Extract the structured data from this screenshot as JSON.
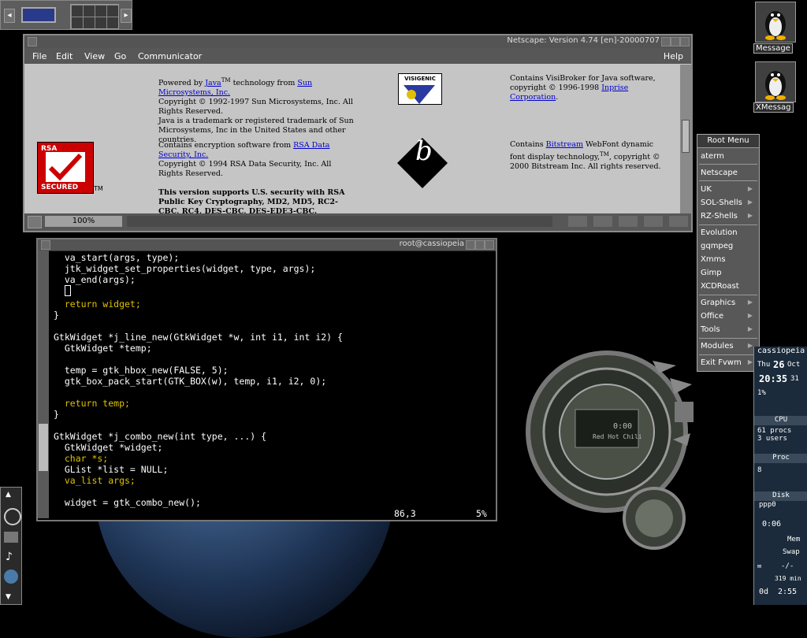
{
  "pager": {
    "left_btn": "◂",
    "right_btn": "▸"
  },
  "netscape": {
    "title": "Netscape: Version 4.74 [en]-20000707",
    "menu": [
      "File",
      "Edit",
      "View",
      "Go",
      "Communicator"
    ],
    "help": "Help",
    "col1": {
      "powered_prefix": "Powered by ",
      "java_link": "Java",
      "tm": "TM",
      "powered_mid": " technology from ",
      "sun_link": "Sun Microsystems, Inc.",
      "copyright_sun": "Copyright © 1992-1997 Sun Microsystems, Inc. All Rights Reserved.",
      "java_tm": "Java is a trademark or registered trademark of Sun Microsystems, Inc in the United States and other countries.",
      "rsa_prefix": "Contains encryption software from ",
      "rsa_link": "RSA Data Security, Inc.",
      "rsa_copyright": "Copyright © 1994 RSA Data Security, Inc. All Rights Reserved.",
      "security_text": "This version supports U.S. security with RSA Public Key Cryptography, MD2, MD5, RC2-CBC, RC4, DES-CBC, DES-EDE3-CBC."
    },
    "col3": {
      "visibroker": "Contains VisiBroker for Java software, copyright © 1996-1998 ",
      "inprise_link": "Inprise Corporation",
      "bitstream_prefix": "Contains ",
      "bitstream_link": "Bitstream",
      "bitstream_rest": " WebFont dynamic font display technology,",
      "bitstream_tm": "TM",
      "bitstream_copy": ", copyright © 2000 Bitstream Inc. All rights reserved."
    },
    "visigenic_label": "VISIGENIC",
    "rsa_logo": {
      "top": "RSA",
      "bottom": "SECURED",
      "tm": "TM"
    },
    "bitstream_letter": "b",
    "progress": "100%"
  },
  "terminal": {
    "title": "root@cassiopeia",
    "position": "86,3",
    "percent": "5%",
    "lines": [
      "  va_start(args, type);",
      "  jtk_widget_set_properties(widget, type, args);",
      "  va_end(args);",
      " ",
      "  return widget;",
      "}",
      "",
      "GtkWidget *j_line_new(GtkWidget *w, int i1, int i2) {",
      "  GtkWidget *temp;",
      "",
      "  temp = gtk_hbox_new(FALSE, 5);",
      "  gtk_box_pack_start(GTK_BOX(w), temp, i1, i2, 0);",
      "",
      "  return temp;",
      "}",
      "",
      "GtkWidget *j_combo_new(int type, ...) {",
      "  GtkWidget *widget;",
      "  char *s;",
      "  GList *list = NULL;",
      "  va_list args;",
      "",
      "  widget = gtk_combo_new();"
    ]
  },
  "root_menu": {
    "title": "Root Menu",
    "items": [
      "aterm",
      "Netscape",
      "UK",
      "SOL-Shells",
      "RZ-Shells",
      "Evolution",
      "gqmpeg",
      "Xmms",
      "Gimp",
      "XCDRoast",
      "Graphics",
      "Office",
      "Tools",
      "Modules",
      "Exit Fvwm"
    ]
  },
  "desktop_icons": [
    {
      "label": "Message"
    },
    {
      "label": "XMessag"
    }
  ],
  "sysmon": {
    "host": "cassiopeia",
    "day": "Thu",
    "date": "26",
    "month": "Oct",
    "time": "20:35",
    "seconds": "31",
    "cpu_pct": "1%",
    "cpu_label": "CPU",
    "procs": "61 procs",
    "users": "3 users",
    "proc_label": "Proc",
    "proc_val": "8",
    "disk_label": "Disk",
    "ppp": "ppp0",
    "ppp_time": "0:06",
    "mem_label": "Mem",
    "swap_label": "Swap",
    "mail": "-/-",
    "battery": "319 min",
    "uptime_days": "0d",
    "uptime": "2:55"
  },
  "player": {
    "time": "0:00",
    "track": "Red Hot Chili"
  }
}
